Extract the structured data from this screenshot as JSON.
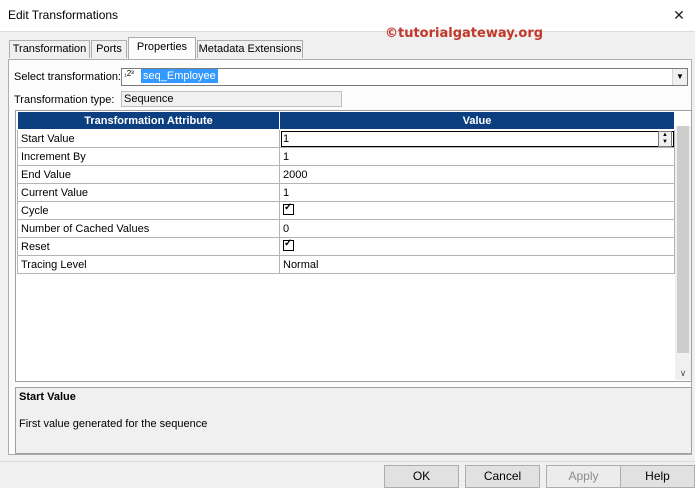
{
  "window": {
    "title": "Edit Transformations",
    "close_glyph": "✕"
  },
  "watermark": "©tutorialgateway.org",
  "tabs": [
    {
      "label": "Transformation",
      "active": false
    },
    {
      "label": "Ports",
      "active": false
    },
    {
      "label": "Properties",
      "active": true
    },
    {
      "label": "Metadata Extensions",
      "active": false
    }
  ],
  "select": {
    "label": "Select transformation:",
    "value": "seq_Employee",
    "icon": "sequence-icon"
  },
  "type": {
    "label": "Transformation type:",
    "value": "Sequence"
  },
  "grid": {
    "headers": [
      "Transformation Attribute",
      "Value"
    ],
    "rows": [
      {
        "attr": "Start Value",
        "value": "1"
      },
      {
        "attr": "Increment By",
        "value": "1"
      },
      {
        "attr": "End Value",
        "value": "2000"
      },
      {
        "attr": "Current Value",
        "value": "1"
      },
      {
        "attr": "Cycle",
        "value": "checked"
      },
      {
        "attr": "Number of Cached Values",
        "value": "0"
      },
      {
        "attr": "Reset",
        "value": "checked"
      },
      {
        "attr": "Tracing Level",
        "value": "Normal"
      }
    ]
  },
  "description": {
    "title": "Start Value",
    "text": "First value generated for the sequence"
  },
  "buttons": {
    "ok": "OK",
    "cancel": "Cancel",
    "apply": "Apply",
    "help": "Help"
  },
  "colors": {
    "header_bg": "#0c3f7f",
    "selection": "#3399ff",
    "watermark": "#c0392b"
  }
}
